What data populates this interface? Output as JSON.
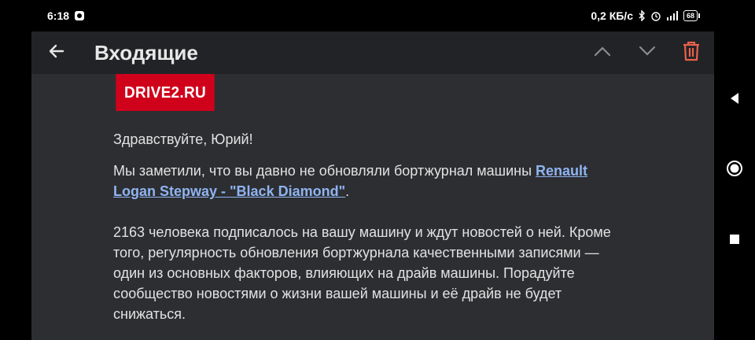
{
  "status_bar": {
    "time": "6:18",
    "network_speed": "0,2 КБ/с",
    "battery": "68"
  },
  "header": {
    "title": "Входящие"
  },
  "email": {
    "logo_text": "DRIVE2.RU",
    "greeting": "Здравствуйте, Юрий!",
    "paragraph1_before": "Мы заметили, что вы давно не обновляли бортжурнал машины ",
    "paragraph1_link": "Renault Logan Stepway - \"Black Diamond\"",
    "paragraph1_after": ".",
    "paragraph2": "2163 человека подписалось на вашу машину и ждут новостей о ней. Кроме того, регулярность обновления бортжурнала качественными записями — один из основных факторов, влияющих на драйв машины. Порадуйте сообщество новостями о жизни вашей машины и её драйв не будет снижаться."
  },
  "colors": {
    "logo_background": "#d0021b",
    "link": "#8fb4f0",
    "delete_icon": "#e8624a",
    "app_background": "#2d2e32",
    "header_background": "#222326"
  }
}
